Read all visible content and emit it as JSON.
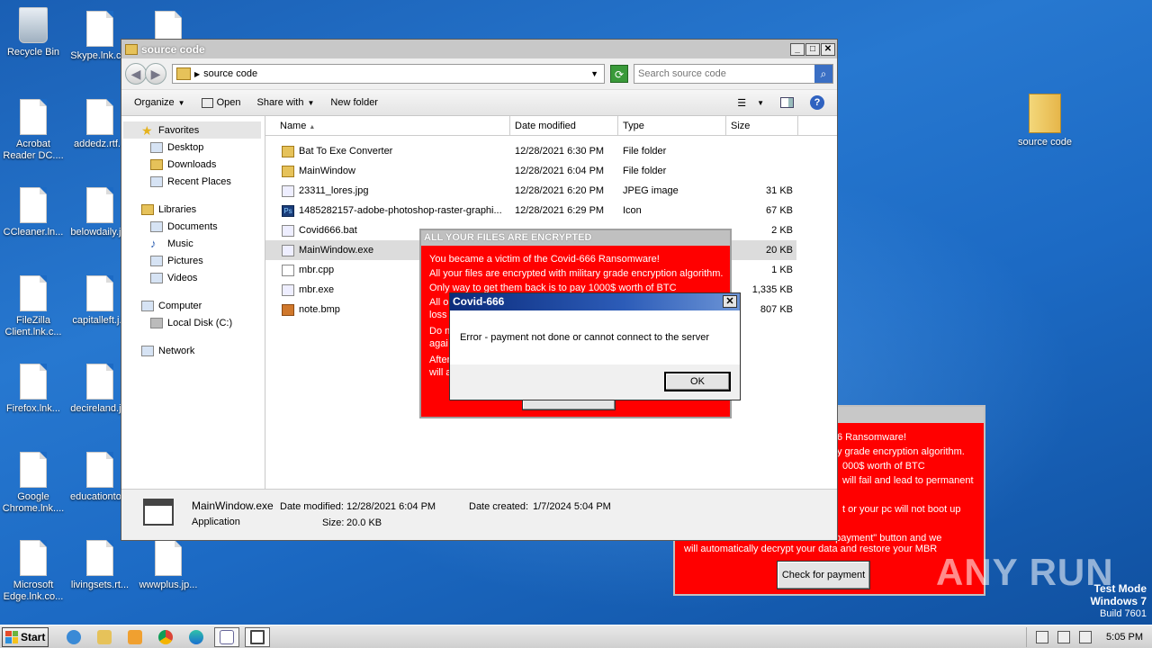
{
  "desktop": {
    "icons": [
      {
        "label": "Recycle Bin"
      },
      {
        "label": "Skype.lnk.c..."
      },
      {
        "label": "Acrobat Reader DC...."
      },
      {
        "label": "addedz.rtf..."
      },
      {
        "label": "CCleaner.ln..."
      },
      {
        "label": "belowdaily.j..."
      },
      {
        "label": "FileZilla Client.lnk.c..."
      },
      {
        "label": "capitalleft.j..."
      },
      {
        "label": "Firefox.lnk..."
      },
      {
        "label": "decireland.j..."
      },
      {
        "label": "Google Chrome.lnk...."
      },
      {
        "label": "educationto..."
      },
      {
        "label": "Microsoft Edge.lnk.co..."
      },
      {
        "label": "livingsets.rt..."
      },
      {
        "label": "wwwplus.jp..."
      },
      {
        "label": "source code"
      }
    ]
  },
  "explorer": {
    "title": "source code",
    "address": "source code",
    "search_placeholder": "Search source code",
    "toolbar": {
      "organize": "Organize",
      "open": "Open",
      "share_with": "Share with",
      "new_folder": "New folder"
    },
    "nav": {
      "favorites": "Favorites",
      "desktop": "Desktop",
      "downloads": "Downloads",
      "recent_places": "Recent Places",
      "libraries": "Libraries",
      "documents": "Documents",
      "music": "Music",
      "pictures": "Pictures",
      "videos": "Videos",
      "computer": "Computer",
      "local_disk": "Local Disk (C:)",
      "network": "Network"
    },
    "columns": {
      "name": "Name",
      "date": "Date modified",
      "type": "Type",
      "size": "Size"
    },
    "files": [
      {
        "name": "Bat To Exe Converter",
        "date": "12/28/2021 6:30 PM",
        "type": "File folder",
        "size": ""
      },
      {
        "name": "MainWindow",
        "date": "12/28/2021 6:04 PM",
        "type": "File folder",
        "size": ""
      },
      {
        "name": "23311_lores.jpg",
        "date": "12/28/2021 6:20 PM",
        "type": "JPEG image",
        "size": "31 KB"
      },
      {
        "name": "1485282157-adobe-photoshop-raster-graphi...",
        "date": "12/28/2021 6:29 PM",
        "type": "Icon",
        "size": "67 KB"
      },
      {
        "name": "Covid666.bat",
        "date": "",
        "type": "",
        "size": "2 KB"
      },
      {
        "name": "MainWindow.exe",
        "date": "",
        "type": "",
        "size": "20 KB"
      },
      {
        "name": "mbr.cpp",
        "date": "",
        "type": "",
        "size": "1 KB"
      },
      {
        "name": "mbr.exe",
        "date": "",
        "type": "",
        "size": "1,335 KB"
      },
      {
        "name": "note.bmp",
        "date": "",
        "type": "",
        "size": "807 KB"
      }
    ],
    "details": {
      "filename": "MainWindow.exe",
      "filetype": "Application",
      "date_modified_label": "Date modified:",
      "date_modified": "12/28/2021 6:04 PM",
      "date_created_label": "Date created:",
      "date_created": "1/7/2024 5:04 PM",
      "size_label": "Size:",
      "size": "20.0 KB"
    }
  },
  "ransom_front": {
    "title": "ALL YOUR FILES ARE ENCRYPTED",
    "lines": [
      "You became a victim of the Covid-666 Ransomware!",
      "All your files are encrypted with military grade encryption algorithm.",
      "Only way to get them back is to pay 1000$ worth of BTC",
      "All o",
      "loss",
      "Do n",
      "agai",
      "After",
      "will a"
    ]
  },
  "ransom_back": {
    "lines": [
      "6 Ransomware!",
      "y grade encryption algorithm.",
      "000$ worth of BTC",
      "will fail and lead to permanent",
      "t or your pc will not boot up",
      "t payment\" button and we",
      "will automatically decrypt your data and restore your MBR"
    ],
    "check_button": "Check for payment"
  },
  "error_dialog": {
    "title": "Covid-666",
    "message": "Error - payment not done or cannot connect to the server",
    "ok": "OK"
  },
  "watermark": {
    "text": "ANY RUN"
  },
  "testmode": {
    "line1": "Test Mode",
    "line2": "Windows 7",
    "line3": "Build 7601"
  },
  "taskbar": {
    "start": "Start",
    "clock": "5:05 PM"
  }
}
